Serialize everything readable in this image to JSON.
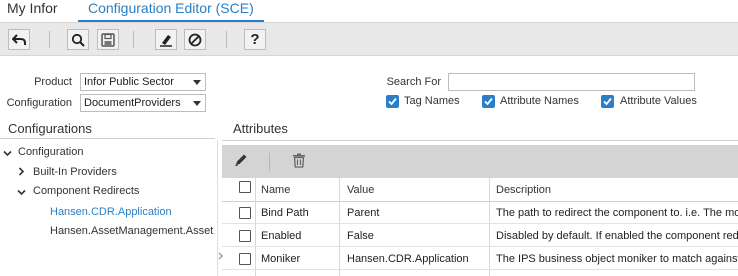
{
  "tabs": [
    {
      "label": "My Infor"
    },
    {
      "label": "Configuration Editor (SCE)"
    }
  ],
  "toolbar": {
    "buttons": [
      "back-arrow-icon",
      "search-icon",
      "save-icon",
      "eraser-icon",
      "cancel-icon",
      "help-icon"
    ],
    "help_label": "?"
  },
  "filters": {
    "product_label": "Product",
    "product_value": "Infor Public Sector",
    "configuration_label": "Configuration",
    "configuration_value": "DocumentProviders",
    "search_label": "Search For",
    "search_value": "",
    "checks": [
      {
        "label": "Tag Names",
        "checked": true
      },
      {
        "label": "Attribute Names",
        "checked": true
      },
      {
        "label": "Attribute Values",
        "checked": true
      }
    ]
  },
  "configurations": {
    "title": "Configurations",
    "tree": [
      {
        "label": "Configuration",
        "expanded": true
      },
      {
        "label": "Built-In Providers",
        "expanded": false
      },
      {
        "label": "Component Redirects",
        "expanded": true
      },
      {
        "label": "Hansen.CDR.Application",
        "selected": true
      },
      {
        "label": "Hansen.AssetManagement.Asset"
      }
    ]
  },
  "attributes": {
    "title": "Attributes",
    "columns": [
      "Name",
      "Value",
      "Description"
    ],
    "rows": [
      {
        "name": "Bind Path",
        "value": "Parent",
        "description": "The path to redirect the component to. i.e. The mon"
      },
      {
        "name": "Enabled",
        "value": "False",
        "description": "Disabled by default. If enabled the component redire"
      },
      {
        "name": "Moniker",
        "value": "Hansen.CDR.Application",
        "description": "The IPS business object moniker to match against. I"
      }
    ]
  },
  "colors": {
    "accent": "#2a7fc7",
    "toolbar_bg": "#e8e8e8",
    "grid_toolbar_bg": "#d4d4d4"
  }
}
